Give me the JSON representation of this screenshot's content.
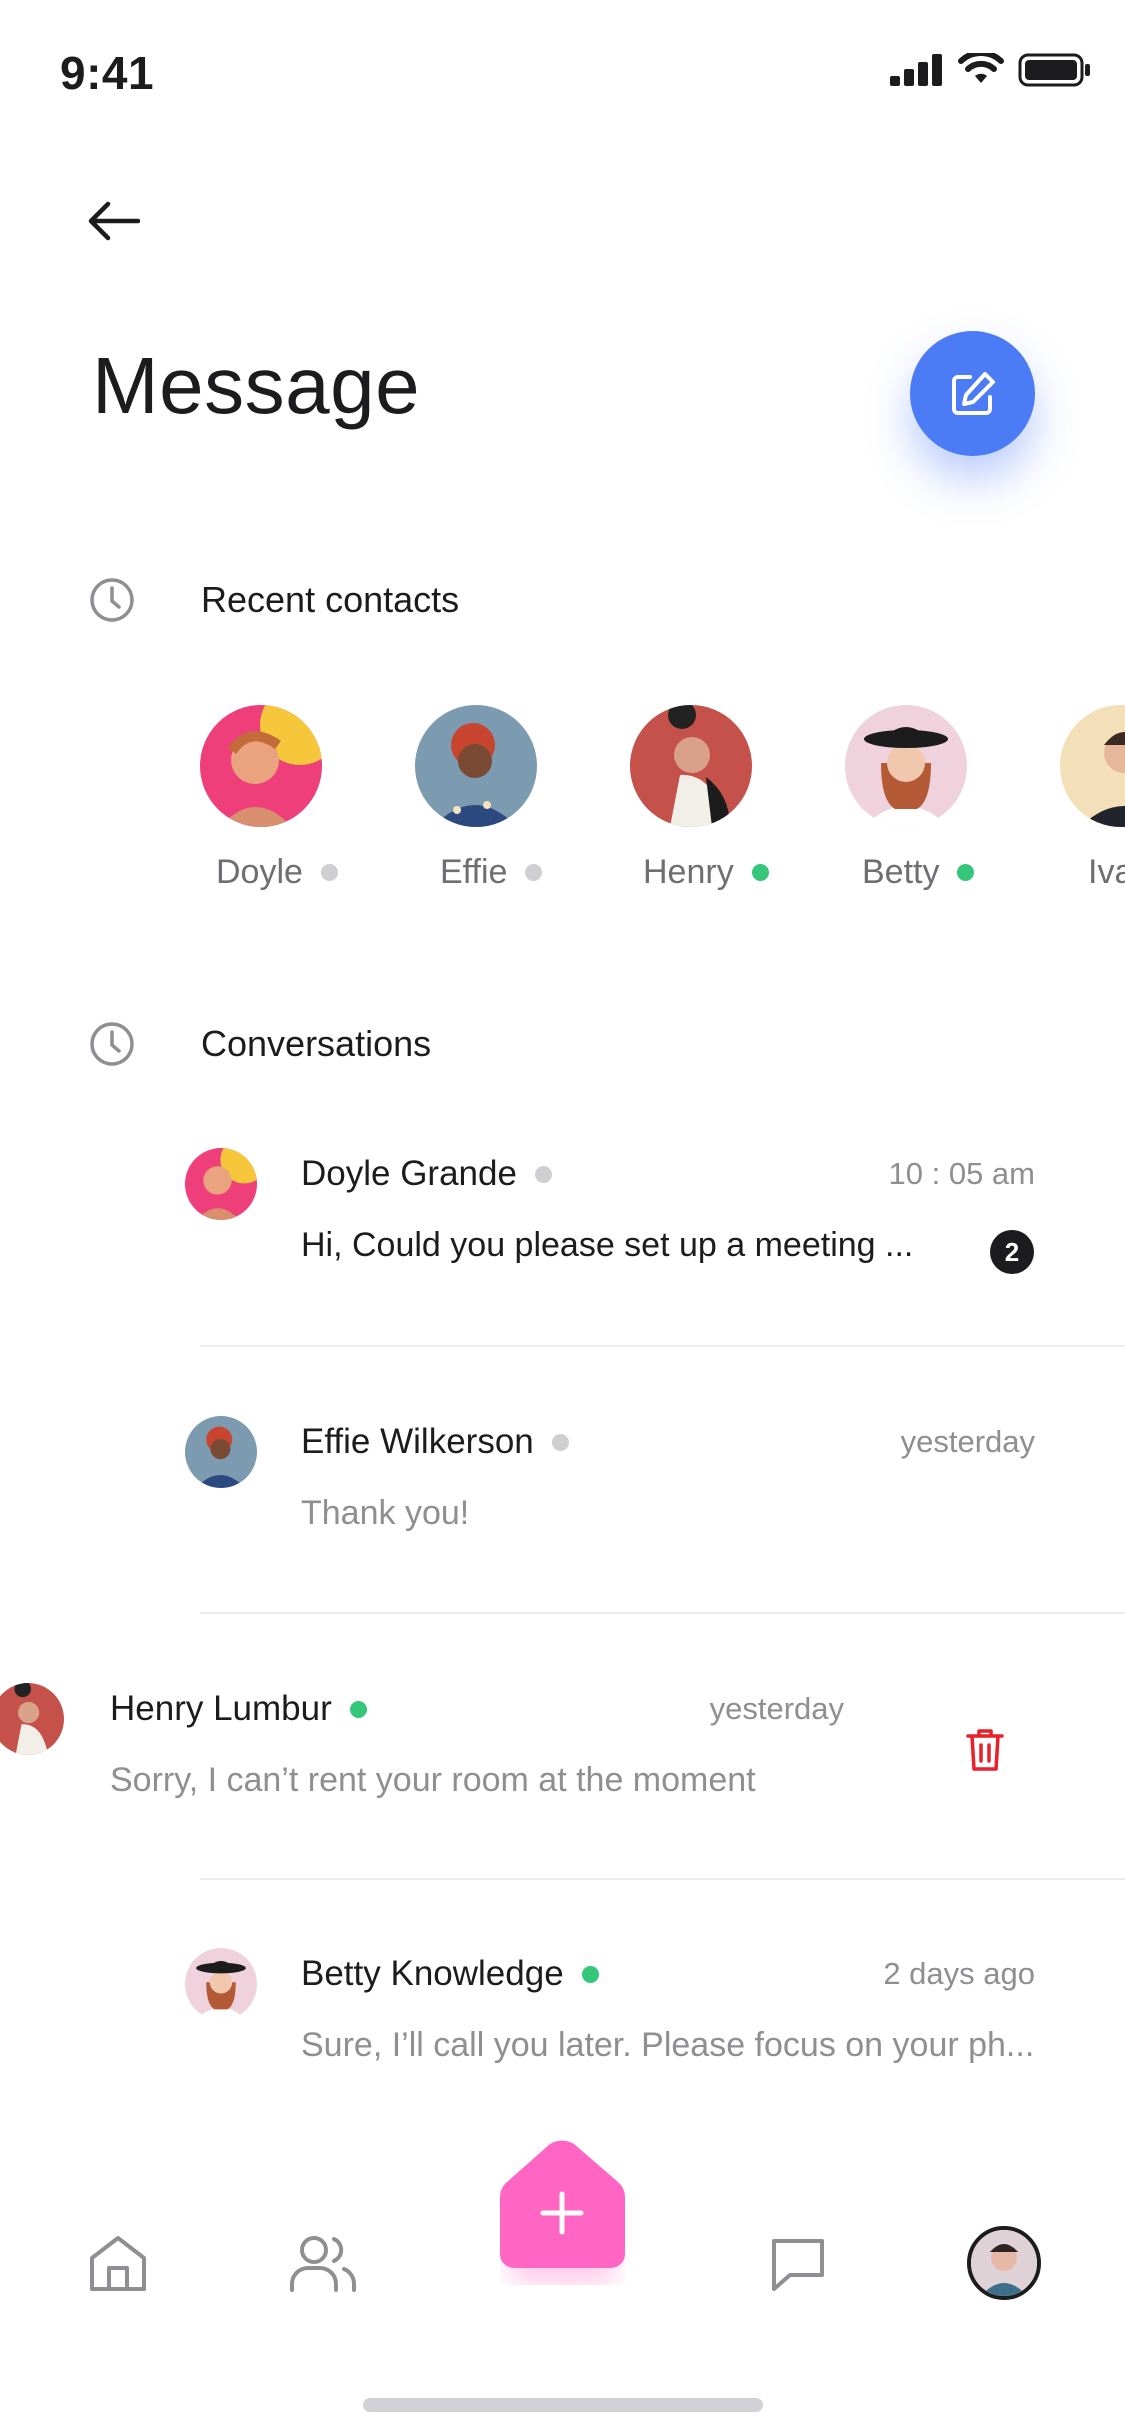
{
  "status_bar": {
    "time": "9:41"
  },
  "header": {
    "title": "Message"
  },
  "recent_section": {
    "label": "Recent contacts"
  },
  "recent_contacts": [
    {
      "name": "Doyle",
      "status": "offline"
    },
    {
      "name": "Effie",
      "status": "offline"
    },
    {
      "name": "Henry",
      "status": "online"
    },
    {
      "name": "Betty",
      "status": "online"
    },
    {
      "name": "Iva",
      "status": ""
    }
  ],
  "conversations_section": {
    "label": "Conversations"
  },
  "conversations": [
    {
      "name": "Doyle Grande",
      "status": "offline",
      "time": "10 : 05 am",
      "preview": "Hi, Could you please set up a meeting ...",
      "unread": "2"
    },
    {
      "name": "Effie Wilkerson",
      "status": "offline",
      "time": "yesterday",
      "preview": "Thank you!"
    },
    {
      "name": "Henry Lumbur",
      "status": "online",
      "time": "yesterday",
      "preview": "Sorry, I can’t rent your room at the moment"
    },
    {
      "name": "Betty Knowledge",
      "status": "online",
      "time": "2 days ago",
      "preview": "Sure, I’ll call you later. Please focus on your ph..."
    }
  ],
  "colors": {
    "accent_blue": "#4b7bf5",
    "accent_pink": "#ff66c4",
    "online_green": "#34c77a",
    "offline_gray": "#cfcfd2",
    "delete_red": "#e8202a"
  },
  "icons": {
    "back": "arrow-left-icon",
    "compose": "edit-icon",
    "recent": "clock-icon",
    "conversations": "clock-icon",
    "delete": "trash-icon",
    "nav_home": "home-icon",
    "nav_contacts": "users-icon",
    "nav_add": "plus-icon",
    "nav_messages": "chat-icon",
    "nav_profile": "avatar"
  }
}
